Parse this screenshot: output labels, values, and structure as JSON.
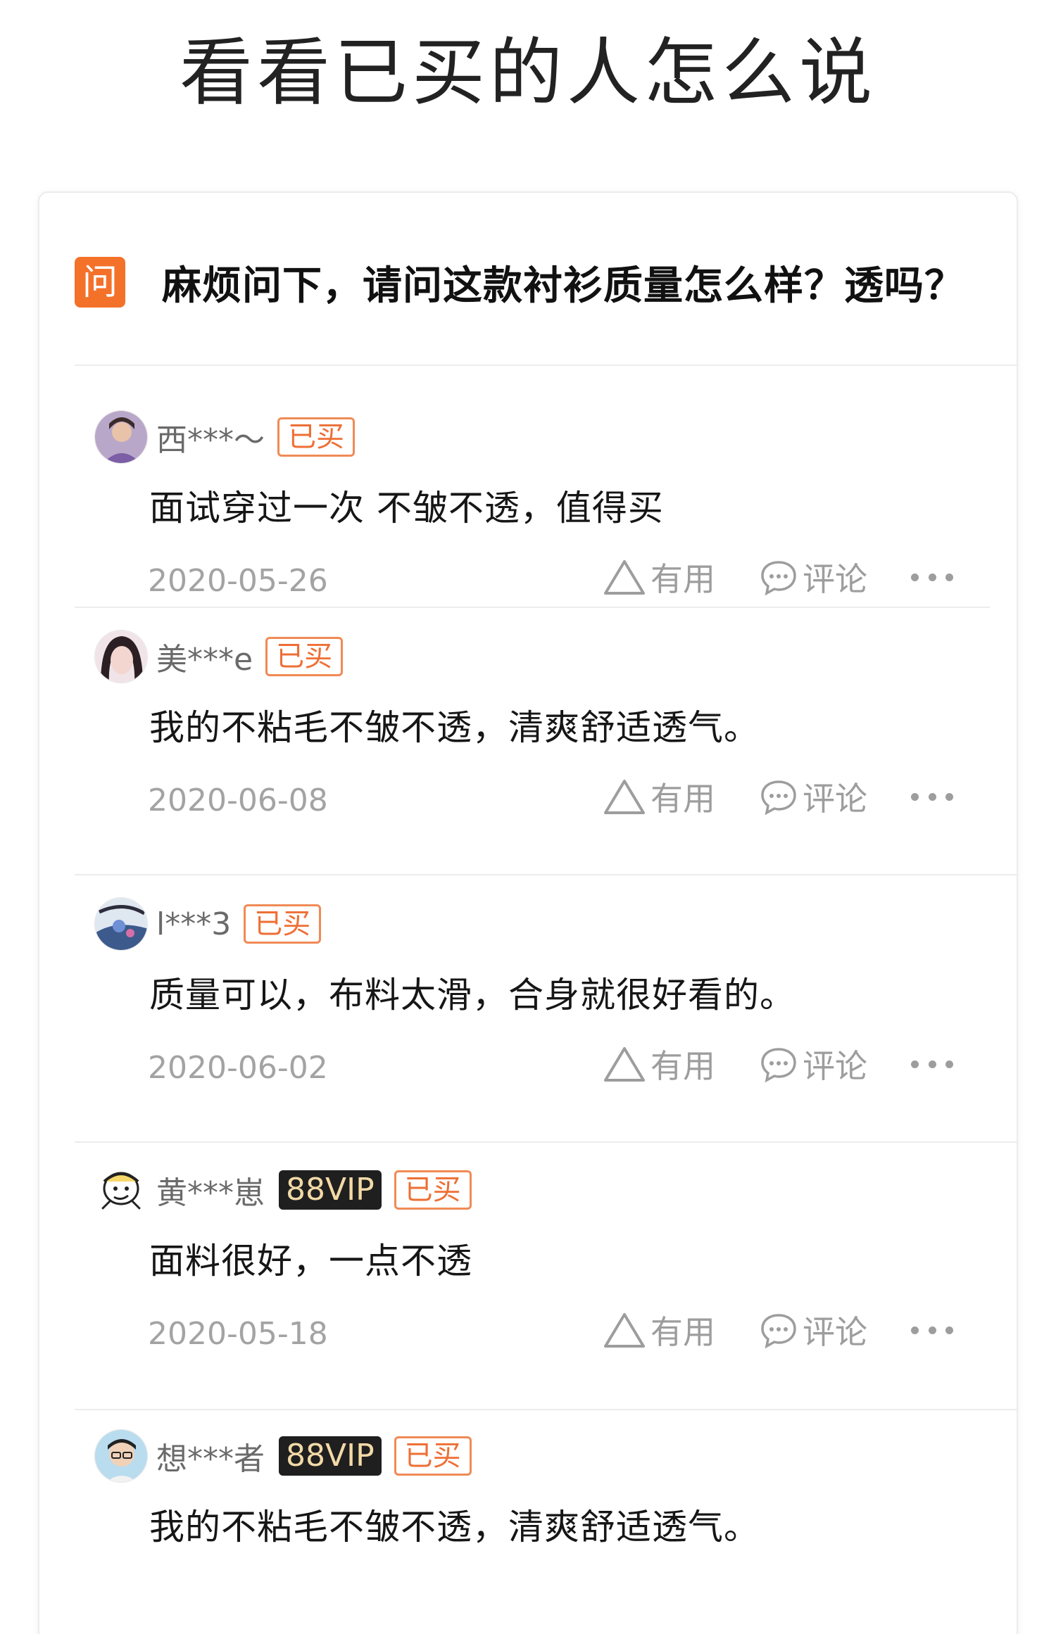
{
  "page": {
    "title": "看看已买的人怎么说"
  },
  "question": {
    "icon_label": "问",
    "text": "麻烦问下，请问这款衬衫质量怎么样？透吗？"
  },
  "actions": {
    "useful_label": "有用",
    "comment_label": "评论",
    "useful_icon": "triangle-up-icon",
    "comment_icon": "speech-bubble-icon",
    "more_icon": "ellipsis-icon"
  },
  "colors": {
    "accent": "#f4712a",
    "bought_badge": "#ee6f35",
    "vip_bg": "#1f1f1f",
    "vip_text": "#f2d9a6"
  },
  "reviews": [
    {
      "nickname": "西***～",
      "vip": "",
      "bought_badge": "已买",
      "text": "面试穿过一次 不皱不透，值得买",
      "date": "2020-05-26",
      "avatar_icon": "user-avatar"
    },
    {
      "nickname": "美***e",
      "vip": "",
      "bought_badge": "已买",
      "text": "我的不粘毛不皱不透，清爽舒适透气。",
      "date": "2020-06-08",
      "avatar_icon": "user-avatar"
    },
    {
      "nickname": "l***3",
      "vip": "",
      "bought_badge": "已买",
      "text": "质量可以，布料太滑，合身就很好看的。",
      "date": "2020-06-02",
      "avatar_icon": "user-avatar"
    },
    {
      "nickname": "黄***崽",
      "vip": "88VIP",
      "bought_badge": "已买",
      "text": "面料很好，一点不透",
      "date": "2020-05-18",
      "avatar_icon": "user-avatar"
    },
    {
      "nickname": "想***者",
      "vip": "88VIP",
      "bought_badge": "已买",
      "text": "我的不粘毛不皱不透，清爽舒适透气。",
      "date": "",
      "avatar_icon": "user-avatar"
    }
  ]
}
